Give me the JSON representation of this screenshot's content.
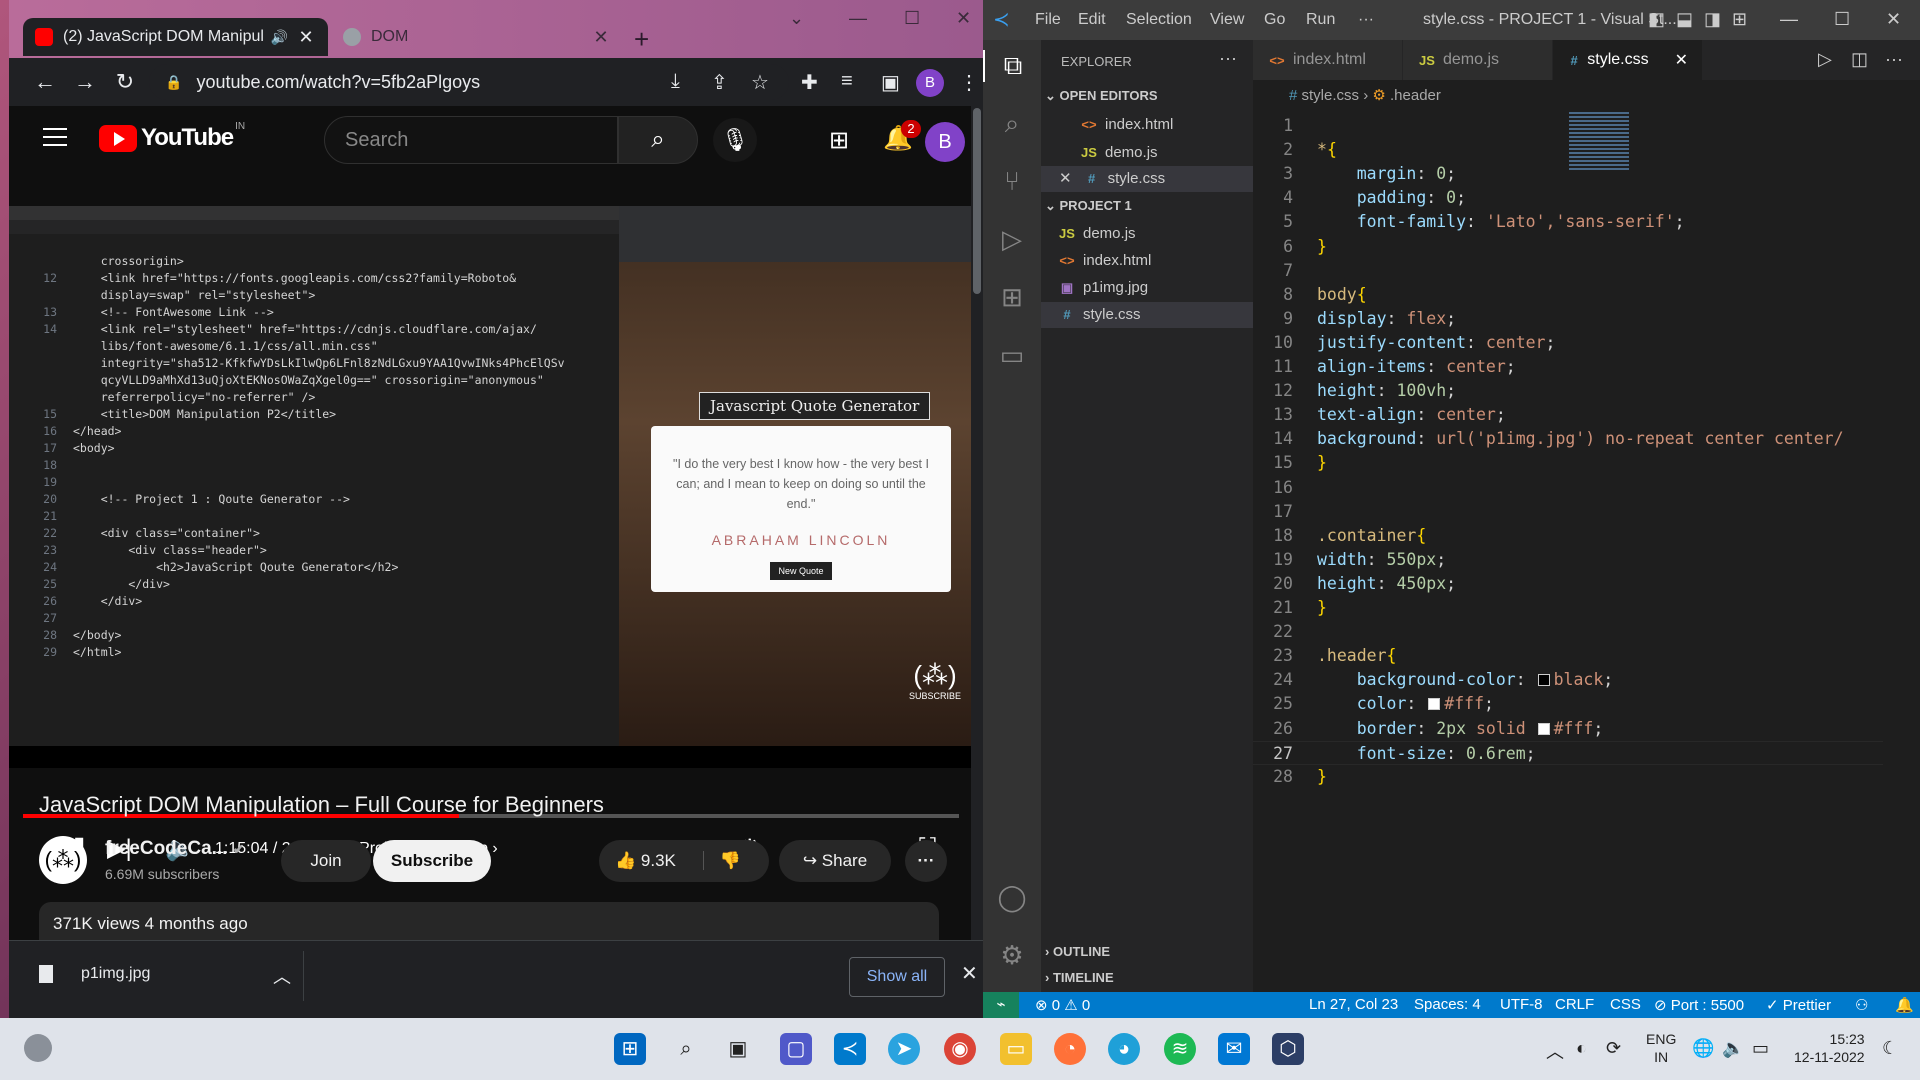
{
  "chrome": {
    "tabs": [
      {
        "title": "(2) JavaScript DOM Manipula",
        "favicon_color": "#ff0000"
      },
      {
        "title": "DOM",
        "favicon_color": "#9aa0a6"
      }
    ],
    "new_tab": "+",
    "url": "youtube.com/watch?v=5fb2aPlgoys",
    "profile_initial": "B"
  },
  "youtube": {
    "logo_text": "YouTube",
    "country": "IN",
    "search_placeholder": "Search",
    "notifications_count": "2",
    "avatar_initial": "B",
    "video": {
      "code_lines": [
        {
          "n": "",
          "t": "    crossorigin>"
        },
        {
          "n": "12",
          "t": "    <link href=\"https://fonts.googleapis.com/css2?family=Roboto&"
        },
        {
          "n": "",
          "t": "    display=swap\" rel=\"stylesheet\">"
        },
        {
          "n": "13",
          "t": "    <!-- FontAwesome Link -->"
        },
        {
          "n": "14",
          "t": "    <link rel=\"stylesheet\" href=\"https://cdnjs.cloudflare.com/ajax/"
        },
        {
          "n": "",
          "t": "    libs/font-awesome/6.1.1/css/all.min.css\""
        },
        {
          "n": "",
          "t": "    integrity=\"sha512-KfkfwYDsLkIlwQp6LFnl8zNdLGxu9YAA1QvwINks4PhcElQSv"
        },
        {
          "n": "",
          "t": "    qcyVLLD9aMhXd13uQjoXtEKNosOWaZqXgel0g==\" crossorigin=\"anonymous\""
        },
        {
          "n": "",
          "t": "    referrerpolicy=\"no-referrer\" />"
        },
        {
          "n": "15",
          "t": "    <title>DOM Manipulation P2</title>"
        },
        {
          "n": "16",
          "t": "</head>"
        },
        {
          "n": "17",
          "t": "<body>"
        },
        {
          "n": "18",
          "t": ""
        },
        {
          "n": "19",
          "t": ""
        },
        {
          "n": "20",
          "t": "    <!-- Project 1 : Qoute Generator -->"
        },
        {
          "n": "21",
          "t": ""
        },
        {
          "n": "22",
          "t": "    <div class=\"container\">"
        },
        {
          "n": "23",
          "t": "        <div class=\"header\">"
        },
        {
          "n": "24",
          "t": "            <h2>JavaScript Qoute Generator</h2>"
        },
        {
          "n": "25",
          "t": "        </div>"
        },
        {
          "n": "26",
          "t": "    </div>"
        },
        {
          "n": "27",
          "t": ""
        },
        {
          "n": "28",
          "t": "</body>"
        },
        {
          "n": "29",
          "t": "</html>"
        }
      ],
      "quote_title": "Javascript Quote Generator",
      "quote_text": "\"I do the very best I know how - the very best I can; and I mean to keep on doing so until the end.\"",
      "quote_author": "ABRAHAM LINCOLN",
      "new_quote_label": "New Quote",
      "watermark": "SUBSCRIBE",
      "time": "1:15:04 / 2:41:20",
      "chapter": "• Project 1 Mark-Up",
      "progress": 0.466
    },
    "title": "JavaScript DOM Manipulation – Full Course for Beginners",
    "channel_name": "freeCodeCa...",
    "subscribers": "6.69M subscribers",
    "join_label": "Join",
    "subscribe_label": "Subscribe",
    "likes": "9.3K",
    "share_label": "Share",
    "views": "371K views  4 months ago"
  },
  "download_bar": {
    "file_name": "p1img.jpg",
    "show_all_label": "Show all"
  },
  "vscode": {
    "menu": [
      "File",
      "Edit",
      "Selection",
      "View",
      "Go",
      "Run",
      "···"
    ],
    "window_title": "style.css - PROJECT 1 - Visual St...",
    "explorer_title": "EXPLORER",
    "open_editors_label": "OPEN EDITORS",
    "open_editors": [
      {
        "type": "<>",
        "name": "index.html"
      },
      {
        "type": "JS",
        "name": "demo.js"
      },
      {
        "type": "#",
        "name": "style.css"
      }
    ],
    "project_label": "PROJECT 1",
    "project_files": [
      {
        "type": "JS",
        "name": "demo.js"
      },
      {
        "type": "<>",
        "name": "index.html"
      },
      {
        "type": "▣",
        "name": "p1img.jpg"
      },
      {
        "type": "#",
        "name": "style.css"
      }
    ],
    "outline_label": "OUTLINE",
    "timeline_label": "TIMELINE",
    "tabs": [
      {
        "type": "<>",
        "name": "index.html"
      },
      {
        "type": "JS",
        "name": "demo.js"
      },
      {
        "type": "#",
        "name": "style.css"
      }
    ],
    "breadcrumb": {
      "file": "style.css",
      "symbol": ".header"
    },
    "code": [
      "",
      "*{",
      "    margin: 0;",
      "    padding: 0;",
      "    font-family: 'Lato','sans-serif';",
      "}",
      "",
      "body{",
      "display: flex;",
      "justify-content: center;",
      "align-items: center;",
      "height: 100vh;",
      "text-align: center;",
      "background: url('p1img.jpg') no-repeat center center/",
      "}",
      "",
      "",
      ".container{",
      "width: 550px;",
      "height: 450px;",
      "}",
      "",
      ".header{",
      "    background-color: black;",
      "    color: #fff;",
      "    border: 2px solid #fff;",
      "    font-size: 0.6rem;",
      "}"
    ],
    "current_line": 27,
    "status": {
      "errors": "⊗ 0 ⚠ 0",
      "position": "Ln 27, Col 23",
      "spaces": "Spaces: 4",
      "encoding": "UTF-8",
      "eol": "CRLF",
      "language": "CSS",
      "port": "⊘ Port : 5500",
      "prettier": "✓ Prettier"
    }
  },
  "taskbar": {
    "lang_1": "ENG",
    "lang_2": "IN",
    "time": "15:23",
    "date": "12-11-2022"
  },
  "colors": {
    "vscode_accent": "#007acc",
    "youtube_red": "#ff0000"
  }
}
